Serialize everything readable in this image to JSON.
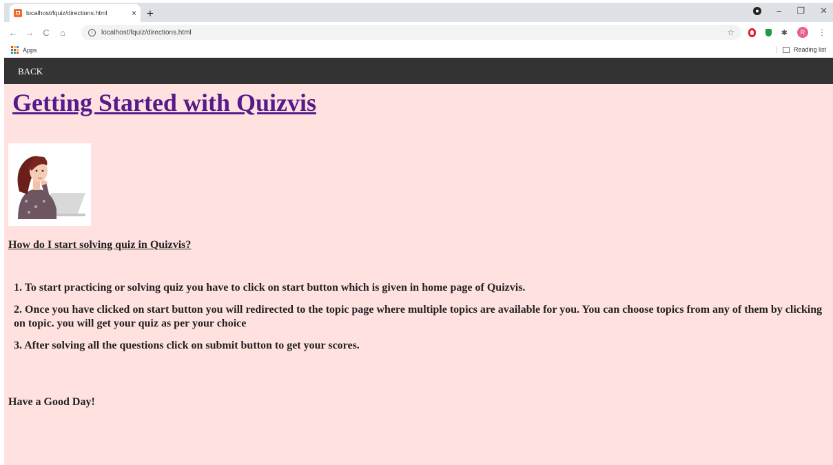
{
  "browser": {
    "tab_title": "localhost/fquiz/directions.html",
    "tab_close": "×",
    "new_tab": "+",
    "address": "localhost/fquiz/directions.html",
    "bookmarks_apps": "Apps",
    "reading_list": "Reading list",
    "profile_initial": "R",
    "window_controls": {
      "minimize": "−",
      "restore": "❐",
      "close": "✕"
    },
    "nav": {
      "back": "←",
      "forward": "→",
      "reload": "C",
      "home": "⌂"
    }
  },
  "navbar": {
    "back_label": "BACK"
  },
  "page": {
    "title": "Getting Started with Quizvis",
    "section_heading": "How do I start solving quiz in Quizvis?",
    "steps": [
      "1. To start practicing or solving quiz you have to click on start button which is given in home page of Quizvis.",
      "2. Once you have clicked on start button you will redirected to the topic page where multiple topics are available for you. You can choose topics from any of them by clicking on topic. you will get your quiz as per your choice",
      "3. After solving all the questions click on submit button to get your scores."
    ],
    "closing": "Have a Good Day!"
  },
  "colors": {
    "page_background": "#ffe2e0",
    "navbar": "#333333",
    "title_link": "#551a8b"
  }
}
